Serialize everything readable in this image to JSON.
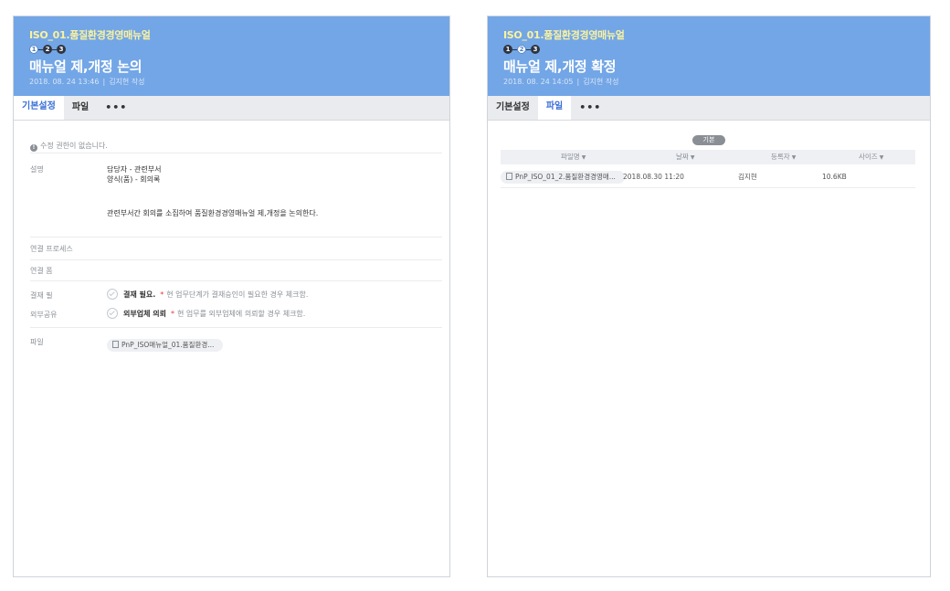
{
  "left": {
    "process_title": "ISO_01.품질환경경영매뉴얼",
    "steps": [
      "1",
      "2",
      "3"
    ],
    "task_title": "매뉴얼 제,개정 논의",
    "date": "2018. 08. 24 13:46",
    "author": "김지현 작성",
    "tabs": [
      "기본설정",
      "파일",
      "•••"
    ],
    "notice": "수정 권한이 없습니다.",
    "desc_label": "설명",
    "desc_line1": "담당자 - 관련부서",
    "desc_line2": "양식(품) - 회의록",
    "desc_line3": "관련부서간 회의를 소집하여 품질환경경영매뉴얼 제,개정을 논의한다.",
    "linked_process_label": "연결 프로세스",
    "linked_form_label": "연결 폼",
    "approval_label": "결재 필",
    "approval_check": "결재 필요.",
    "approval_note": "현 업무단계가 결재승인이 필요한 경우 체크함.",
    "share_label": "외부공유",
    "share_check": "외부업체 의뢰",
    "share_note": "현 업무를 외부업체에 의뢰할 경우 체크함.",
    "file_label": "파일",
    "file_name": "PnP_ISO매뉴얼_01.품질환경..."
  },
  "right": {
    "process_title": "ISO_01.품질환경경영매뉴얼",
    "steps": [
      "1",
      "2",
      "3"
    ],
    "task_title": "매뉴얼 제,개정 확정",
    "date": "2018. 08. 24 14:05",
    "author": "김지현 작성",
    "tabs": [
      "기본설정",
      "파일",
      "•••"
    ],
    "badge": "기본",
    "columns": [
      "파일명",
      "날짜",
      "등록자",
      "사이즈"
    ],
    "files": [
      {
        "name": "PnP_ISO_01_2.품질환경경영매...",
        "date": "2018.08.30 11:20",
        "registrant": "김지현",
        "size": "10.6KB"
      }
    ]
  },
  "colors": {
    "header_bg": "#73a6e6",
    "process_title": "#fbf29e",
    "active_tab": "#3a6fd8",
    "required_star": "#e53935"
  }
}
